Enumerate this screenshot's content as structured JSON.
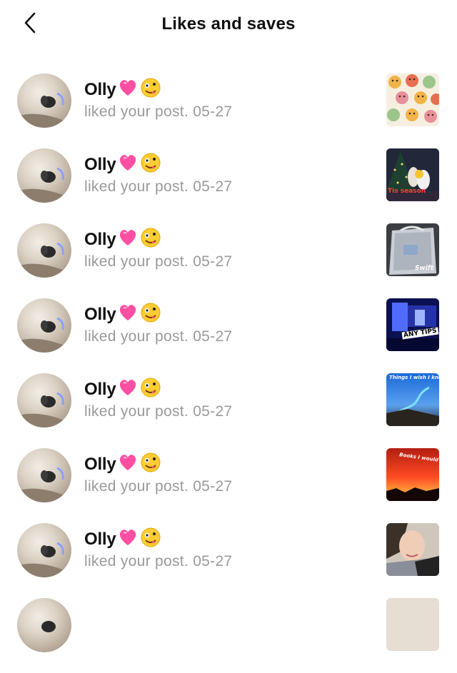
{
  "header": {
    "title": "Likes and saves",
    "back_icon": "chevron-left-icon"
  },
  "notifications": [
    {
      "name": "Olly",
      "action": "liked your post.",
      "date": "05-27",
      "thumb": "smiley-pattern"
    },
    {
      "name": "Olly",
      "action": "liked your post.",
      "date": "05-27",
      "thumb": "christmas-tree-photo",
      "thumb_text": "Tis season"
    },
    {
      "name": "Olly",
      "action": "liked your post.",
      "date": "05-27",
      "thumb": "shopping-bag-photo",
      "thumb_text": "Swift"
    },
    {
      "name": "Olly",
      "action": "liked your post.",
      "date": "05-27",
      "thumb": "night-room-photo",
      "thumb_text": "ANY TIPS"
    },
    {
      "name": "Olly",
      "action": "liked your post.",
      "date": "05-27",
      "thumb": "sky-path-photo",
      "thumb_text": "Things I wish I knew"
    },
    {
      "name": "Olly",
      "action": "liked your post.",
      "date": "05-27",
      "thumb": "sunset-photo",
      "thumb_text": "Books I would die"
    },
    {
      "name": "Olly",
      "action": "liked your post.",
      "date": "05-27",
      "thumb": "selfie-photo"
    }
  ],
  "colors": {
    "text_primary": "#111111",
    "text_secondary": "#9a9a9a",
    "heart": "#ff4fa3",
    "background": "#ffffff"
  }
}
